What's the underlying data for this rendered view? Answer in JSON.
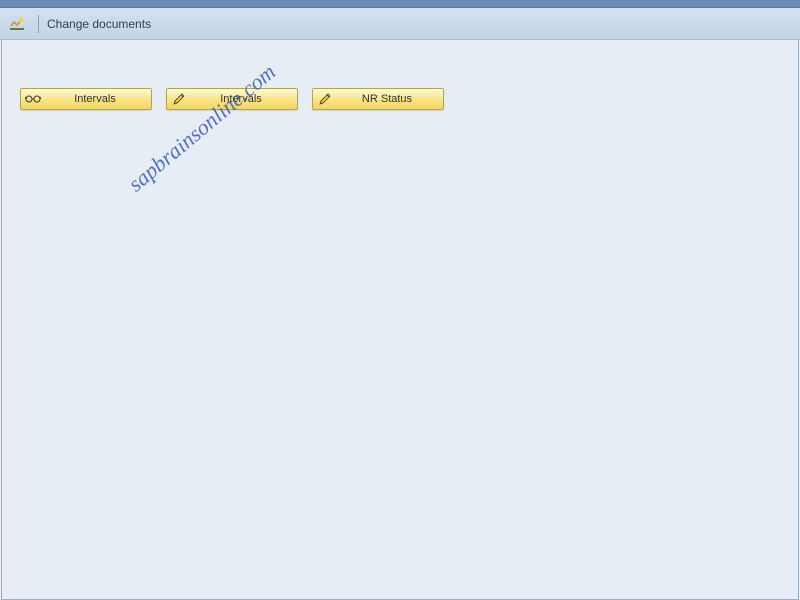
{
  "toolbar": {
    "title": "Change documents"
  },
  "buttons": {
    "display_intervals": "Intervals",
    "change_intervals": "Intervals",
    "nr_status": "NR Status"
  },
  "watermark": "sapbrainsonline.com",
  "colors": {
    "toolbar_bg": "#c2d4e6",
    "content_bg": "#e6edf4",
    "button_bg": "#f3d760",
    "watermark_color": "#3b5bbf"
  }
}
